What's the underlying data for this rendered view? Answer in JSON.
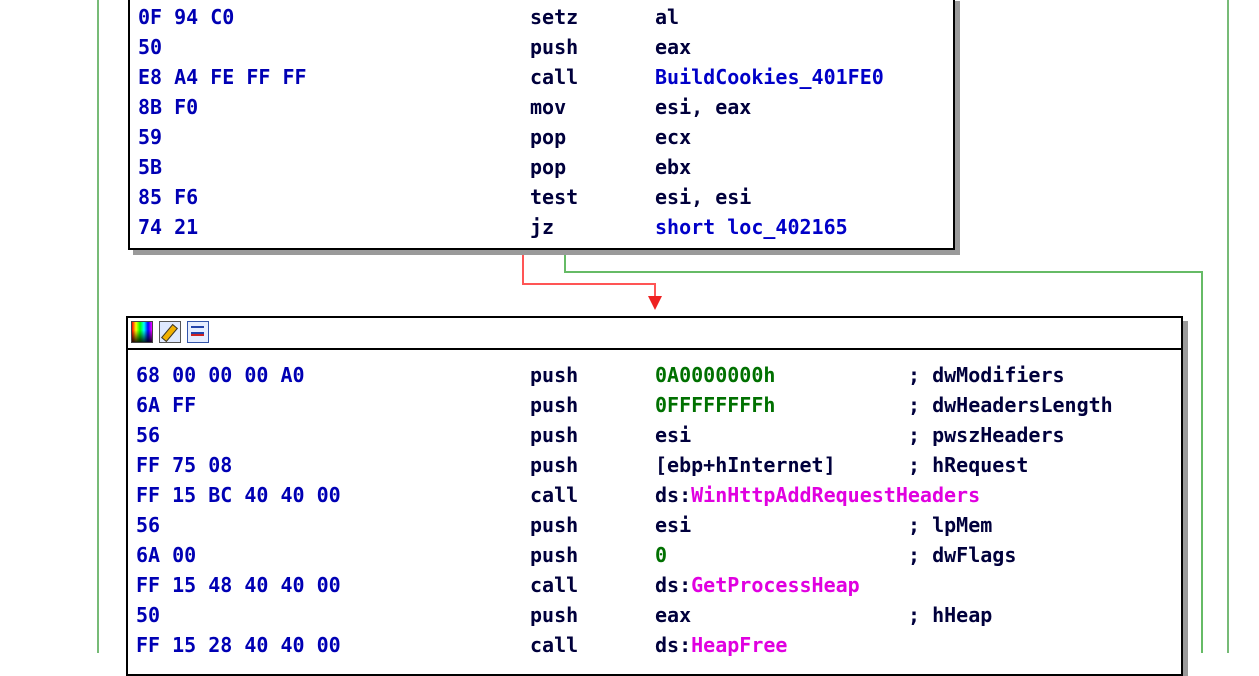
{
  "block1": {
    "rows": [
      {
        "bytes": "0F 94 C0",
        "mnem": "setz",
        "operand": "al"
      },
      {
        "bytes": "50",
        "mnem": "push",
        "operand": "eax"
      },
      {
        "bytes": "E8 A4 FE FF FF",
        "mnem": "call",
        "operand": "BuildCookies_401FE0"
      },
      {
        "bytes": "8B F0",
        "mnem": "mov",
        "operand": "esi, eax"
      },
      {
        "bytes": "59",
        "mnem": "pop",
        "operand": "ecx"
      },
      {
        "bytes": "5B",
        "mnem": "pop",
        "operand": "ebx"
      },
      {
        "bytes": "85 F6",
        "mnem": "test",
        "operand": "esi, esi"
      },
      {
        "bytes": "74 21",
        "mnem": "jz",
        "operand": "short loc_402165"
      }
    ]
  },
  "block2": {
    "toolbar_icons": [
      "color-palette-icon",
      "rename-icon",
      "graph-view-icon"
    ],
    "rows": [
      {
        "bytes": "68 00 00 00 A0",
        "mnem": "push",
        "prefix": "",
        "operand": "0A0000000h",
        "comment": "; dwModifiers"
      },
      {
        "bytes": "6A FF",
        "mnem": "push",
        "prefix": "",
        "operand": "0FFFFFFFFh",
        "comment": "; dwHeadersLength"
      },
      {
        "bytes": "56",
        "mnem": "push",
        "prefix": "",
        "operand": "esi",
        "comment": "; pwszHeaders"
      },
      {
        "bytes": "FF 75 08",
        "mnem": "push",
        "prefix": "",
        "operand": "[ebp+hInternet]",
        "comment": "; hRequest"
      },
      {
        "bytes": "FF 15 BC 40 40 00",
        "mnem": "call",
        "prefix": "ds:",
        "operand": "WinHttpAddRequestHeaders",
        "comment": ""
      },
      {
        "bytes": "56",
        "mnem": "push",
        "prefix": "",
        "operand": "esi",
        "comment": "; lpMem"
      },
      {
        "bytes": "6A 00",
        "mnem": "push",
        "prefix": "",
        "operand": "0",
        "comment": "; dwFlags"
      },
      {
        "bytes": "FF 15 48 40 40 00",
        "mnem": "call",
        "prefix": "ds:",
        "operand": "GetProcessHeap",
        "comment": ""
      },
      {
        "bytes": "50",
        "mnem": "push",
        "prefix": "",
        "operand": "eax",
        "comment": "; hHeap"
      },
      {
        "bytes": "FF 15 28 40 40 00",
        "mnem": "call",
        "prefix": "ds:",
        "operand": "HeapFree",
        "comment": ""
      }
    ]
  },
  "edges": {
    "taken_color": "#ff5555",
    "fallthrough_color": "#66bb66",
    "lane_color": "#77bb77"
  }
}
